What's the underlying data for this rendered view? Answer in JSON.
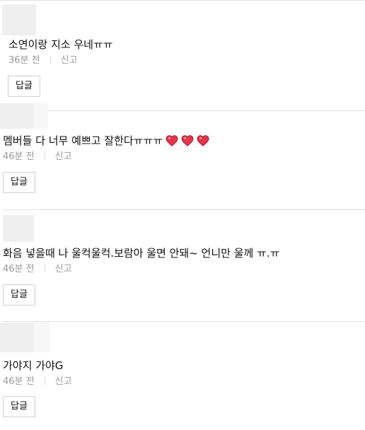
{
  "comments": [
    {
      "text": "소연이랑 지소 우네ㅠㅠ",
      "time": "36분 전",
      "report": "신고",
      "reply": "답글",
      "hearts": 0
    },
    {
      "text": "멤버들 다 너무 예쁘고 잘한다ㅠㅠㅠ",
      "time": "46분 전",
      "report": "신고",
      "reply": "답글",
      "hearts": 3
    },
    {
      "text": "화음 넣을때 나 울컥울컥.보람아 울면 안돼~ 언니만 울께 ㅠ.ㅠ",
      "time": "46분 전",
      "report": "신고",
      "reply": "답글",
      "hearts": 0
    },
    {
      "text": "가야지 가야G",
      "time": "46분 전",
      "report": "신고",
      "reply": "답글",
      "hearts": 0
    }
  ],
  "icons": {
    "heart": "heart-emoji-icon"
  },
  "colors": {
    "heart_fill": "#e6344a",
    "meta_text": "#9a9a9a"
  }
}
